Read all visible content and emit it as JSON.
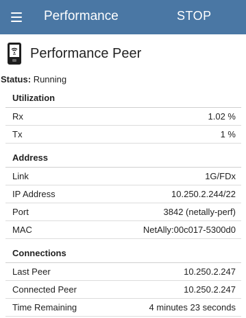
{
  "appbar": {
    "title": "Performance",
    "stop_label": "STOP"
  },
  "peer": {
    "title": "Performance Peer"
  },
  "status": {
    "label": "Status:",
    "value": "Running"
  },
  "sections": [
    {
      "header": "Utilization",
      "rows": [
        {
          "label": "Rx",
          "value": "1.02 %"
        },
        {
          "label": "Tx",
          "value": "1 %"
        }
      ]
    },
    {
      "header": "Address",
      "rows": [
        {
          "label": "Link",
          "value": "1G/FDx"
        },
        {
          "label": "IP Address",
          "value": "10.250.2.244/22"
        },
        {
          "label": "Port",
          "value": "3842 (netally-perf)"
        },
        {
          "label": "MAC",
          "value": "NetAlly:00c017-5300d0"
        }
      ]
    },
    {
      "header": "Connections",
      "rows": [
        {
          "label": "Last Peer",
          "value": "10.250.2.247"
        },
        {
          "label": "Connected Peer",
          "value": "10.250.2.247"
        },
        {
          "label": "Time Remaining",
          "value": "4 minutes 23 seconds"
        }
      ]
    }
  ]
}
